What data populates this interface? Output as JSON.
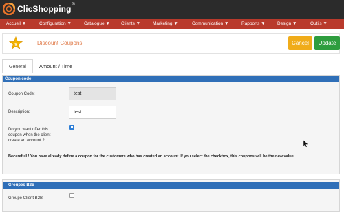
{
  "app": {
    "name": "ClicShopping",
    "reg_mark": "®"
  },
  "menu": [
    "Accueil ▼",
    "Configuration ▼",
    "Catalogue ▼",
    "Clients ▼",
    "Marketing ▼",
    "Communication ▼",
    "Rapports ▼",
    "Design ▼",
    "Outils ▼"
  ],
  "header": {
    "title": "Discount Coupons",
    "cancel_label": "Cancel",
    "update_label": "Update"
  },
  "tabs": [
    {
      "label": "General",
      "active": true
    },
    {
      "label": "Amount / Time",
      "active": false
    }
  ],
  "coupon_section": {
    "title": "Coupon code",
    "code_label": "Coupon Code:",
    "code_value": "test",
    "description_label": "Description:",
    "description_value": "test",
    "offer_label": "Do you want offer this coupon when the client create an account ?",
    "offer_checked": true,
    "warning": "Becarefull ! You have already define a coupon for the customers who has created an account. If you select the checkbox, this coupons will be the new value"
  },
  "b2b_section": {
    "title": "Groupes B2B",
    "group_label": "Groupe Client B2B",
    "group_checked": false
  },
  "colors": {
    "menubar": "#b93a2c",
    "topbar": "#2b2b2b",
    "section_header": "#2f6fb8",
    "cancel": "#f0ac1a",
    "update": "#2e9d3e",
    "title": "#e07b4a"
  }
}
